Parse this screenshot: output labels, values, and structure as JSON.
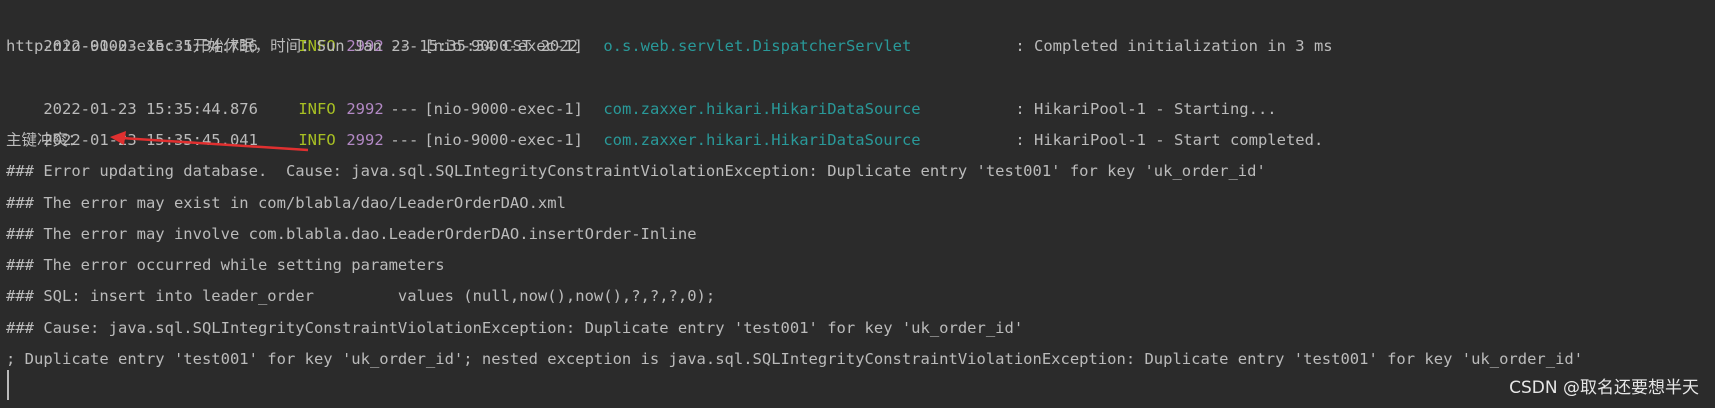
{
  "console": {
    "log_lines": [
      {
        "timestamp": "2022-01-23 15:35:34.736",
        "level": "INFO",
        "pid": "2992",
        "dashes": "---",
        "thread": "[nio-9000-exec-1]",
        "logger": "o.s.web.servlet.DispatcherServlet",
        "message": ": Completed initialization in 3 ms"
      },
      {
        "timestamp": "2022-01-23 15:35:44.876",
        "level": "INFO",
        "pid": "2992",
        "dashes": "---",
        "thread": "[nio-9000-exec-1]",
        "logger": "com.zaxxer.hikari.HikariDataSource",
        "message": ": HikariPool-1 - Starting..."
      },
      {
        "timestamp": "2022-01-23 15:35:45.041",
        "level": "INFO",
        "pid": "2992",
        "dashes": "---",
        "thread": "[nio-9000-exec-1]",
        "logger": "com.zaxxer.hikari.HikariDataSource",
        "message": ": HikariPool-1 - Start completed."
      }
    ],
    "plain_lines": {
      "sleep_line": "http-nio-9000-exec-1开始休眠，时间：Sun Jan 23 15:35:34 CST 2022",
      "conflict_label": "主键冲突：",
      "error_updating": "### Error updating database.  Cause: java.sql.SQLIntegrityConstraintViolationException: Duplicate entry 'test001' for key 'uk_order_id'",
      "error_exist": "### The error may exist in com/blabla/dao/LeaderOrderDAO.xml",
      "error_involve": "### The error may involve com.blabla.dao.LeaderOrderDAO.insertOrder-Inline",
      "error_occurred": "### The error occurred while setting parameters",
      "sql": "### SQL: insert into leader_order         values (null,now(),now(),?,?,?,0);",
      "cause": "### Cause: java.sql.SQLIntegrityConstraintViolationException: Duplicate entry 'test001' for key 'uk_order_id'",
      "nested": "; Duplicate entry 'test001' for key 'uk_order_id'; nested exception is java.sql.SQLIntegrityConstraintViolationException: Duplicate entry 'test001' for key 'uk_order_id'"
    },
    "watermark": "CSDN @取名还要想半天",
    "colors": {
      "background": "#2b2b2b",
      "text": "#bbbbbb",
      "level": "#a8c023",
      "pid": "#b389c5",
      "logger": "#299999",
      "arrow": "#e03030"
    }
  }
}
